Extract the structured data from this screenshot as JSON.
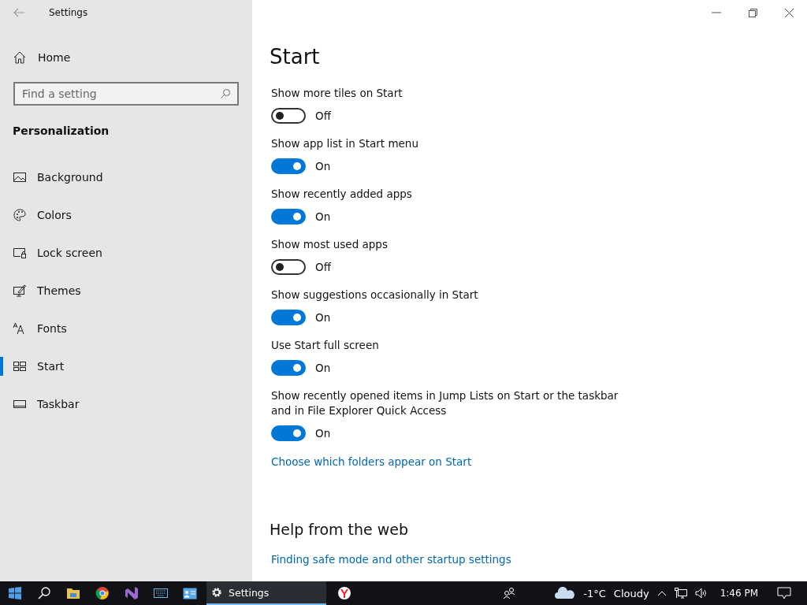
{
  "window": {
    "title": "Settings"
  },
  "sidebar": {
    "home": "Home",
    "search": {
      "placeholder": "Find a setting"
    },
    "section": "Personalization",
    "items": [
      {
        "label": "Background",
        "selected": false
      },
      {
        "label": "Colors",
        "selected": false
      },
      {
        "label": "Lock screen",
        "selected": false
      },
      {
        "label": "Themes",
        "selected": false
      },
      {
        "label": "Fonts",
        "selected": false
      },
      {
        "label": "Start",
        "selected": true
      },
      {
        "label": "Taskbar",
        "selected": false
      }
    ]
  },
  "page": {
    "title": "Start",
    "settings": [
      {
        "label": "Show more tiles on Start",
        "on": false,
        "state": "Off"
      },
      {
        "label": "Show app list in Start menu",
        "on": true,
        "state": "On"
      },
      {
        "label": "Show recently added apps",
        "on": true,
        "state": "On"
      },
      {
        "label": "Show most used apps",
        "on": false,
        "state": "Off"
      },
      {
        "label": "Show suggestions occasionally in Start",
        "on": true,
        "state": "On"
      },
      {
        "label": "Use Start full screen",
        "on": true,
        "state": "On"
      },
      {
        "label": "Show recently opened items in Jump Lists on Start or the taskbar and in File Explorer Quick Access",
        "on": true,
        "state": "On"
      }
    ],
    "link": "Choose which folders appear on Start",
    "help": {
      "title": "Help from the web",
      "links": [
        "Finding safe mode and other startup settings"
      ]
    }
  },
  "taskbar": {
    "active_app": "Settings",
    "temperature": "-1°C",
    "weather": "Cloudy",
    "time": "1:46 PM"
  }
}
